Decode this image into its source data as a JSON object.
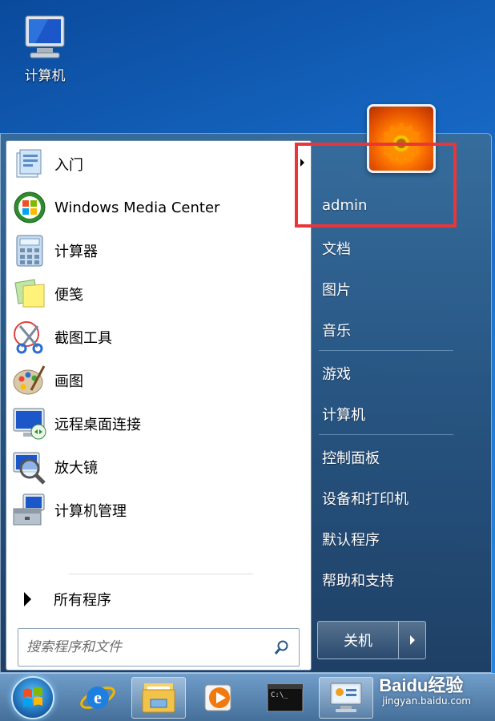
{
  "desktop": {
    "computer_label": "计算机"
  },
  "start_menu": {
    "programs": [
      {
        "label": "入门",
        "icon": "getting-started-icon",
        "has_submenu": true
      },
      {
        "label": "Windows Media Center",
        "icon": "media-center-icon",
        "has_submenu": false
      },
      {
        "label": "计算器",
        "icon": "calculator-icon",
        "has_submenu": false
      },
      {
        "label": "便笺",
        "icon": "sticky-notes-icon",
        "has_submenu": false
      },
      {
        "label": "截图工具",
        "icon": "snipping-tool-icon",
        "has_submenu": false
      },
      {
        "label": "画图",
        "icon": "paint-icon",
        "has_submenu": false
      },
      {
        "label": "远程桌面连接",
        "icon": "remote-desktop-icon",
        "has_submenu": false
      },
      {
        "label": "放大镜",
        "icon": "magnifier-icon",
        "has_submenu": false
      },
      {
        "label": "计算机管理",
        "icon": "computer-management-icon",
        "has_submenu": false
      }
    ],
    "all_programs_label": "所有程序",
    "search_placeholder": "搜索程序和文件",
    "right_items": {
      "user": "admin",
      "documents": "文档",
      "pictures": "图片",
      "music": "音乐",
      "games": "游戏",
      "computer": "计算机",
      "control_panel": "控制面板",
      "devices_printers": "设备和打印机",
      "default_programs": "默认程序",
      "help_support": "帮助和支持"
    },
    "shutdown_label": "关机",
    "highlight_color": "#e8363a"
  },
  "taskbar": {
    "items": [
      "start-orb",
      "internet-explorer-icon",
      "explorer-folder-icon",
      "media-player-icon",
      "command-prompt-icon",
      "control-panel-icon"
    ],
    "cmd_text": "C:\\_"
  },
  "watermark": {
    "brand": "Baidu经验",
    "url": "jingyan.baidu.com"
  }
}
